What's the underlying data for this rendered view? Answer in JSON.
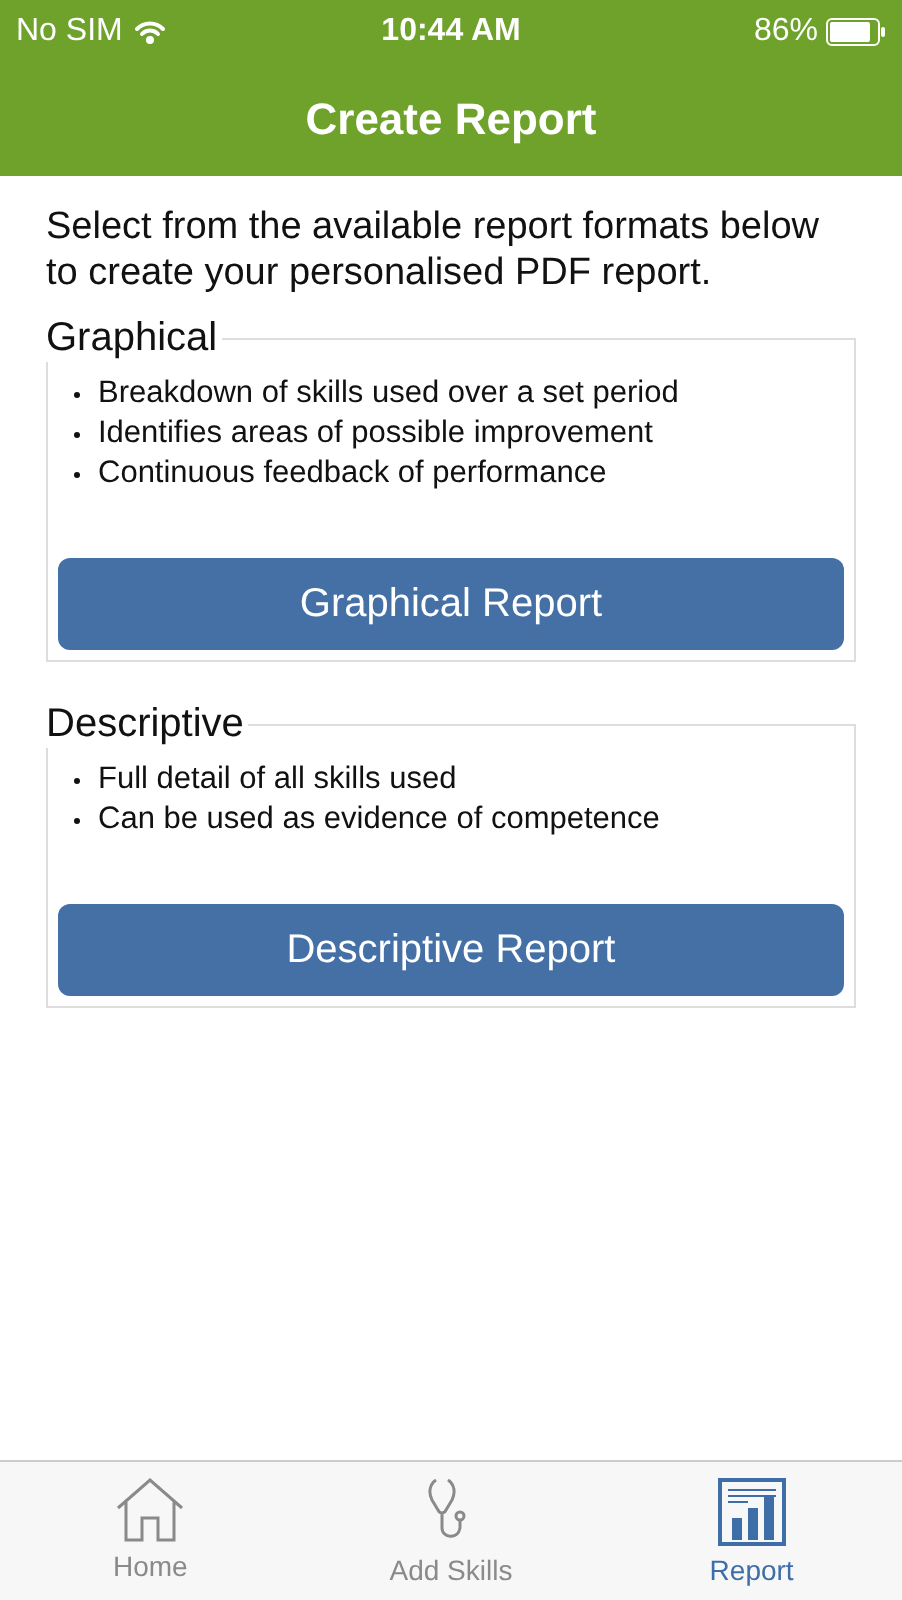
{
  "status_bar": {
    "carrier": "No SIM",
    "time": "10:44 AM",
    "battery": "86%"
  },
  "nav_bar": {
    "title": "Create Report"
  },
  "intro": "Select from the available report formats below to create your personalised PDF report.",
  "sections": [
    {
      "title": "Graphical",
      "bullets": [
        "Breakdown of skills used over a set period",
        "Identifies areas of possible improvement",
        "Continuous feedback of performance"
      ],
      "button": "Graphical Report"
    },
    {
      "title": "Descriptive",
      "bullets": [
        "Full detail of all skills used",
        "Can be used as evidence of competence"
      ],
      "button": "Descriptive Report"
    }
  ],
  "tab_bar": [
    {
      "kind": "home",
      "label": "Home",
      "selected": false
    },
    {
      "kind": "skills",
      "label": "Add Skills",
      "selected": false
    },
    {
      "kind": "report",
      "label": "Report",
      "selected": true
    }
  ]
}
